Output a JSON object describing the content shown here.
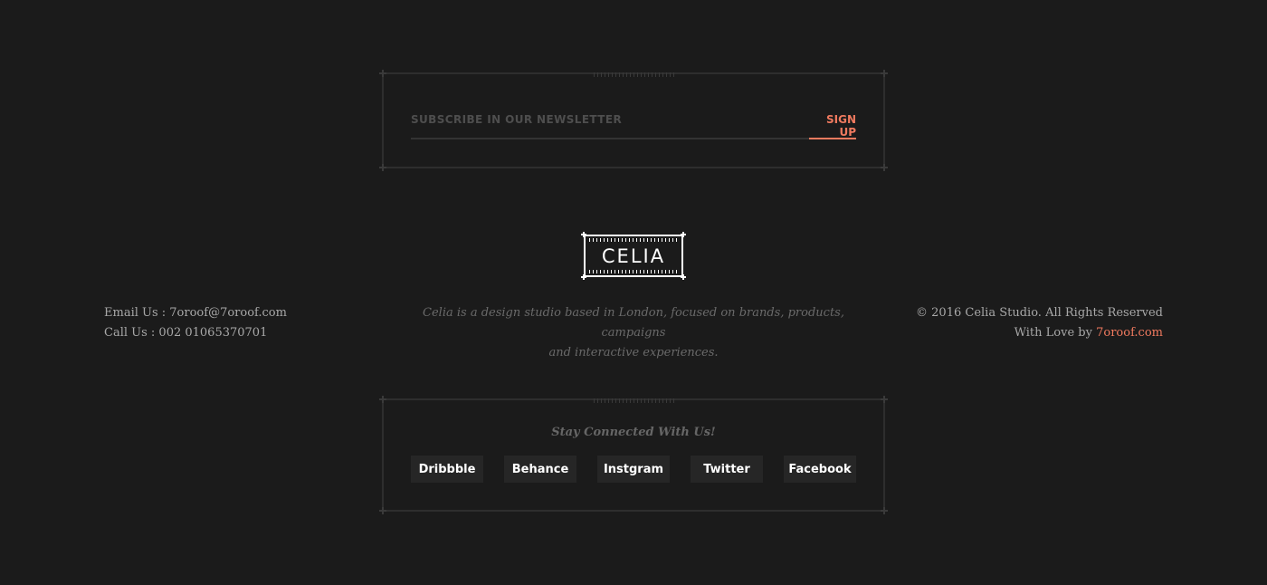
{
  "newsletter": {
    "placeholder": "SUBSCRIBE IN OUR NEWSLETTER",
    "button_label": "SIGN UP"
  },
  "logo": {
    "text": "CELIA"
  },
  "contact": {
    "email": "Email Us : 7oroof@7oroof.com",
    "phone": "Call Us : 002 01065370701"
  },
  "about": {
    "line1": "Celia is a design studio based in London, focused on brands, products, campaigns",
    "line2": "and interactive experiences."
  },
  "copyright": {
    "line1": "© 2016 Celia Studio. All Rights Reserved",
    "with_love": "With Love by",
    "link_text": "7oroof.com"
  },
  "social": {
    "heading": "Stay Connected With Us!",
    "links": [
      {
        "label": "Dribbble"
      },
      {
        "label": "Behance"
      },
      {
        "label": "Instgram"
      },
      {
        "label": "Twitter"
      },
      {
        "label": "Facebook"
      }
    ]
  },
  "colors": {
    "background": "#1b1b1b",
    "accent": "#f07a5f",
    "frame": "#2e2e2e"
  }
}
